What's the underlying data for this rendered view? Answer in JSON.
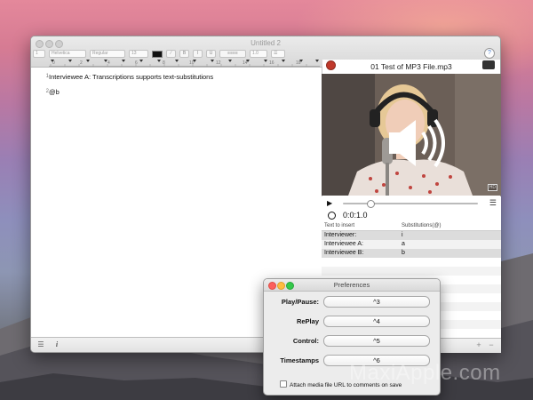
{
  "main_window": {
    "title": "Untitled 2",
    "toolbar": {
      "paragraph_spacing": "1",
      "font_family": "Helvetica",
      "font_style": "Regular",
      "font_size": "13",
      "bold_label": "B",
      "italic_label": "I",
      "underline_label": "U",
      "line_spacing": "1.0"
    },
    "ruler_numbers": [
      "0",
      "2",
      "4",
      "6",
      "8",
      "10",
      "12",
      "14",
      "16",
      "18"
    ],
    "help_label": "?"
  },
  "editor": {
    "lines": [
      {
        "number": "1",
        "text": "Interviewee A: Transcriptions supports text-substitutions"
      },
      {
        "number": "2",
        "text": "@b"
      }
    ]
  },
  "player": {
    "file_title": "01 Test of MP3 File.mp3",
    "hd_badge": "HD",
    "time": "0:0:1.0",
    "progress": 0.2
  },
  "substitutions": {
    "col1_header": "Text to insert",
    "col2_header": "Substitutions(@)",
    "rows": [
      {
        "text": "Interviewer:",
        "key": "i"
      },
      {
        "text": "Interviewee A:",
        "key": "a"
      },
      {
        "text": "Interviewee B:",
        "key": "b"
      }
    ]
  },
  "preferences": {
    "title": "Preferences",
    "fields": [
      {
        "label": "Play/Pause:",
        "value": "^3"
      },
      {
        "label": "RePlay",
        "value": "^4"
      },
      {
        "label": "Control:",
        "value": "^5"
      },
      {
        "label": "Timestamps",
        "value": "^6"
      }
    ],
    "checkbox_label": "Attach media file URL to comments on save",
    "checkbox_checked": false
  },
  "watermark": "MaxiApple.com",
  "colors": {
    "close": "#fc605c",
    "minimize": "#fdbc40",
    "zoom": "#34c84a",
    "highlight_row": "#dcdcdc"
  }
}
